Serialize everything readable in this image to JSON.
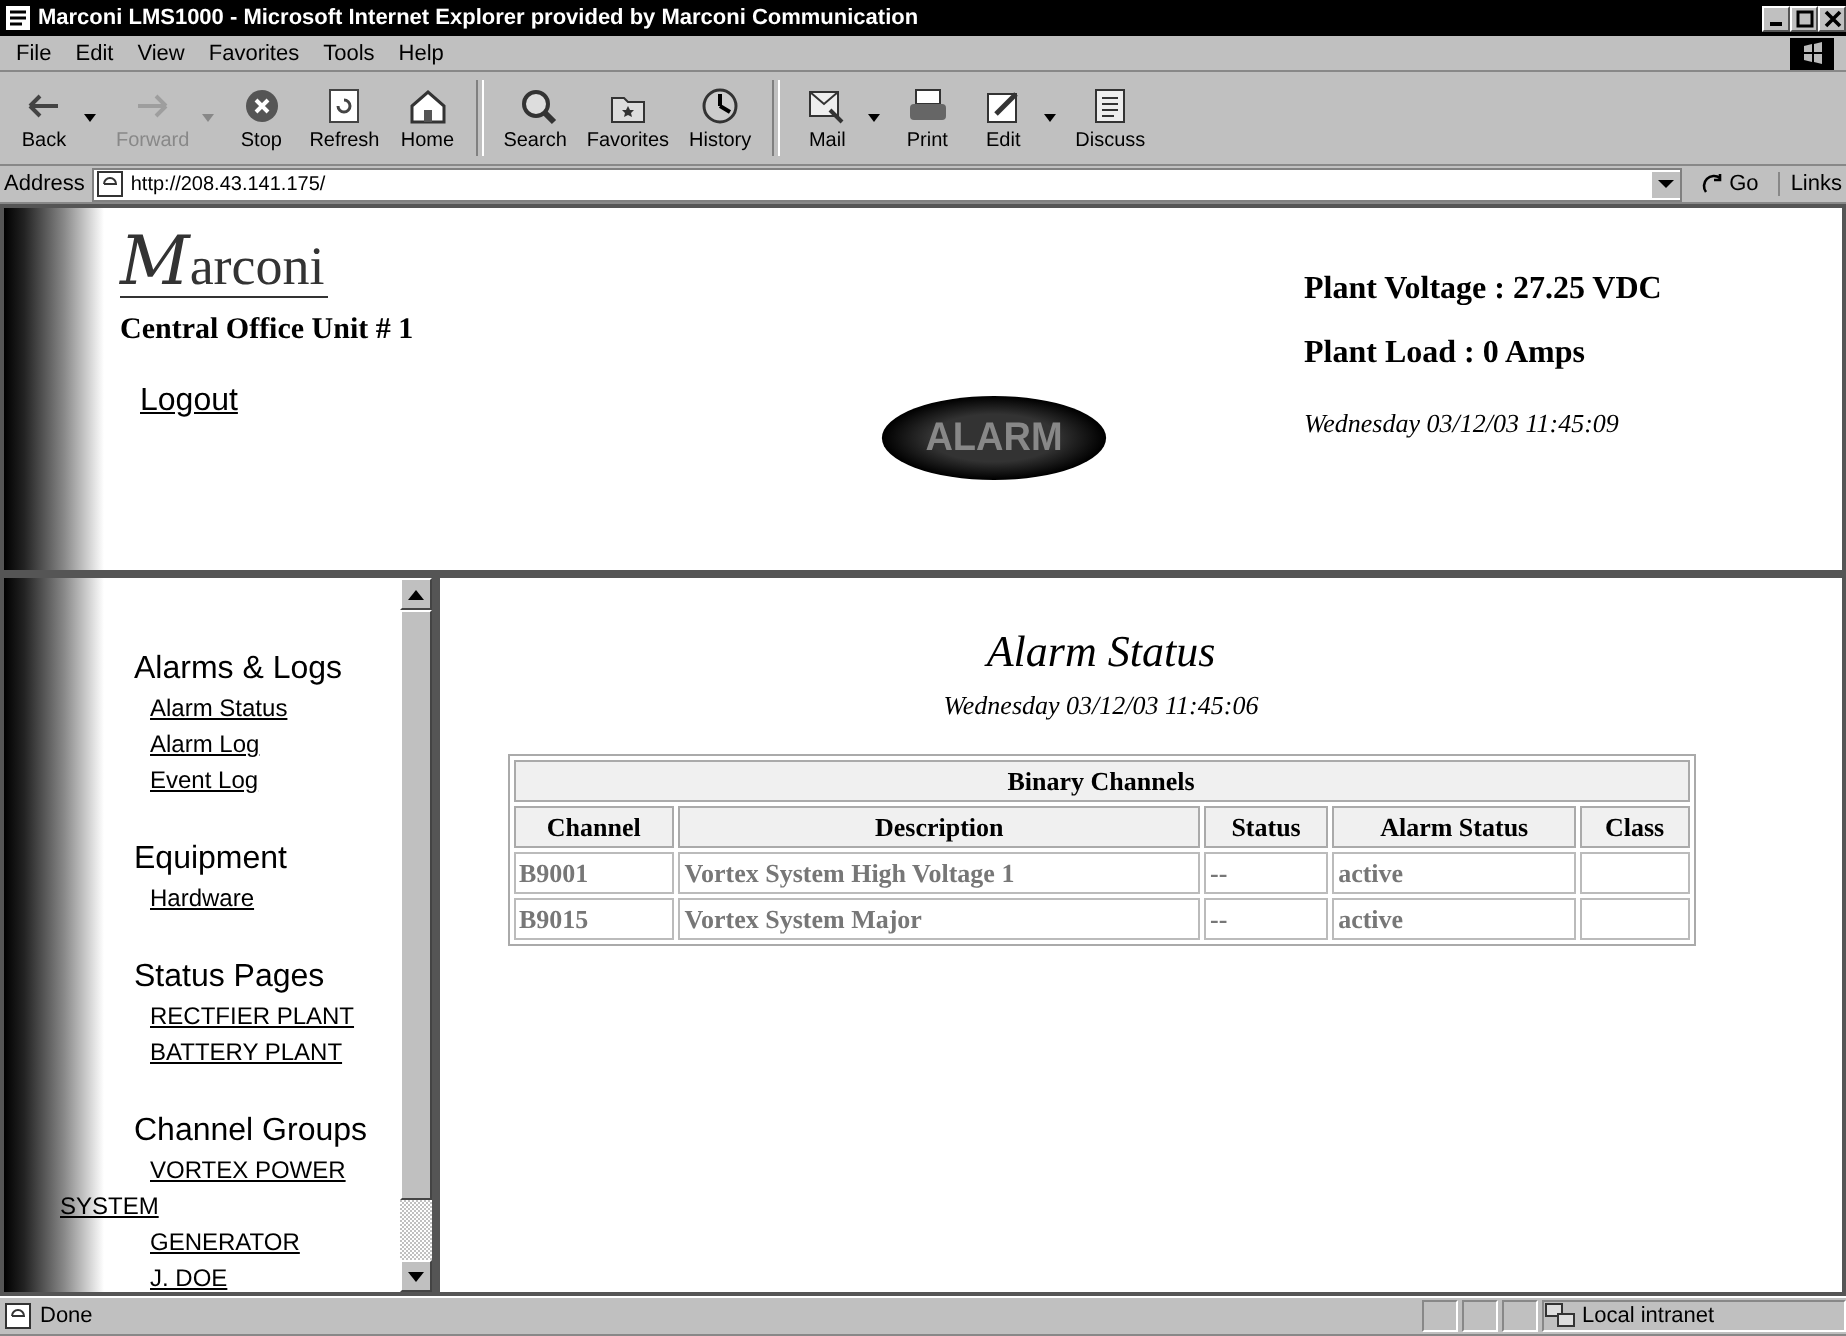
{
  "window": {
    "title": "Marconi LMS1000 - Microsoft Internet Explorer provided by Marconi Communication"
  },
  "menu": [
    "File",
    "Edit",
    "View",
    "Favorites",
    "Tools",
    "Help"
  ],
  "toolbar": [
    [
      {
        "label": "Back",
        "disabled": false,
        "dropdown": true
      },
      {
        "label": "Forward",
        "disabled": true,
        "dropdown": true
      },
      {
        "label": "Stop",
        "disabled": false,
        "dropdown": false
      },
      {
        "label": "Refresh",
        "disabled": false,
        "dropdown": false
      },
      {
        "label": "Home",
        "disabled": false,
        "dropdown": false
      }
    ],
    [
      {
        "label": "Search",
        "disabled": false,
        "dropdown": false
      },
      {
        "label": "Favorites",
        "disabled": false,
        "dropdown": false
      },
      {
        "label": "History",
        "disabled": false,
        "dropdown": false
      }
    ],
    [
      {
        "label": "Mail",
        "disabled": false,
        "dropdown": true
      },
      {
        "label": "Print",
        "disabled": false,
        "dropdown": false
      },
      {
        "label": "Edit",
        "disabled": false,
        "dropdown": true
      },
      {
        "label": "Discuss",
        "disabled": false,
        "dropdown": false
      }
    ]
  ],
  "address": {
    "label": "Address",
    "value": "http://208.43.141.175/",
    "go": "Go",
    "links": "Links"
  },
  "header": {
    "logo": "Marconi",
    "unit": "Central Office Unit # 1",
    "logout": "Logout",
    "alarm": "ALARM",
    "voltage": "Plant Voltage : 27.25 VDC",
    "load": "Plant Load : 0 Amps",
    "datetime": "Wednesday 03/12/03 11:45:09"
  },
  "sidebar": {
    "sections": [
      {
        "title": "Alarms & Logs",
        "items": [
          "Alarm Status",
          "Alarm Log",
          "Event Log"
        ]
      },
      {
        "title": "Equipment",
        "items": [
          "Hardware"
        ]
      },
      {
        "title": "Status Pages",
        "items": [
          "RECTFIER PLANT",
          "BATTERY PLANT"
        ]
      },
      {
        "title": "Channel Groups",
        "items": [
          "VORTEX POWER SYSTEM",
          "GENERATOR",
          "J. DOE"
        ]
      }
    ]
  },
  "main": {
    "title": "Alarm Status",
    "datetime": "Wednesday 03/12/03 11:45:06",
    "table": {
      "caption": "Binary Channels",
      "columns": [
        "Channel",
        "Description",
        "Status",
        "Alarm Status",
        "Class"
      ],
      "rows": [
        [
          "B9001",
          "Vortex System High Voltage 1",
          "--",
          "active",
          ""
        ],
        [
          "B9015",
          "Vortex System Major",
          "--",
          "active",
          ""
        ]
      ]
    }
  },
  "status_bar": {
    "text": "Done",
    "zone": "Local intranet"
  }
}
